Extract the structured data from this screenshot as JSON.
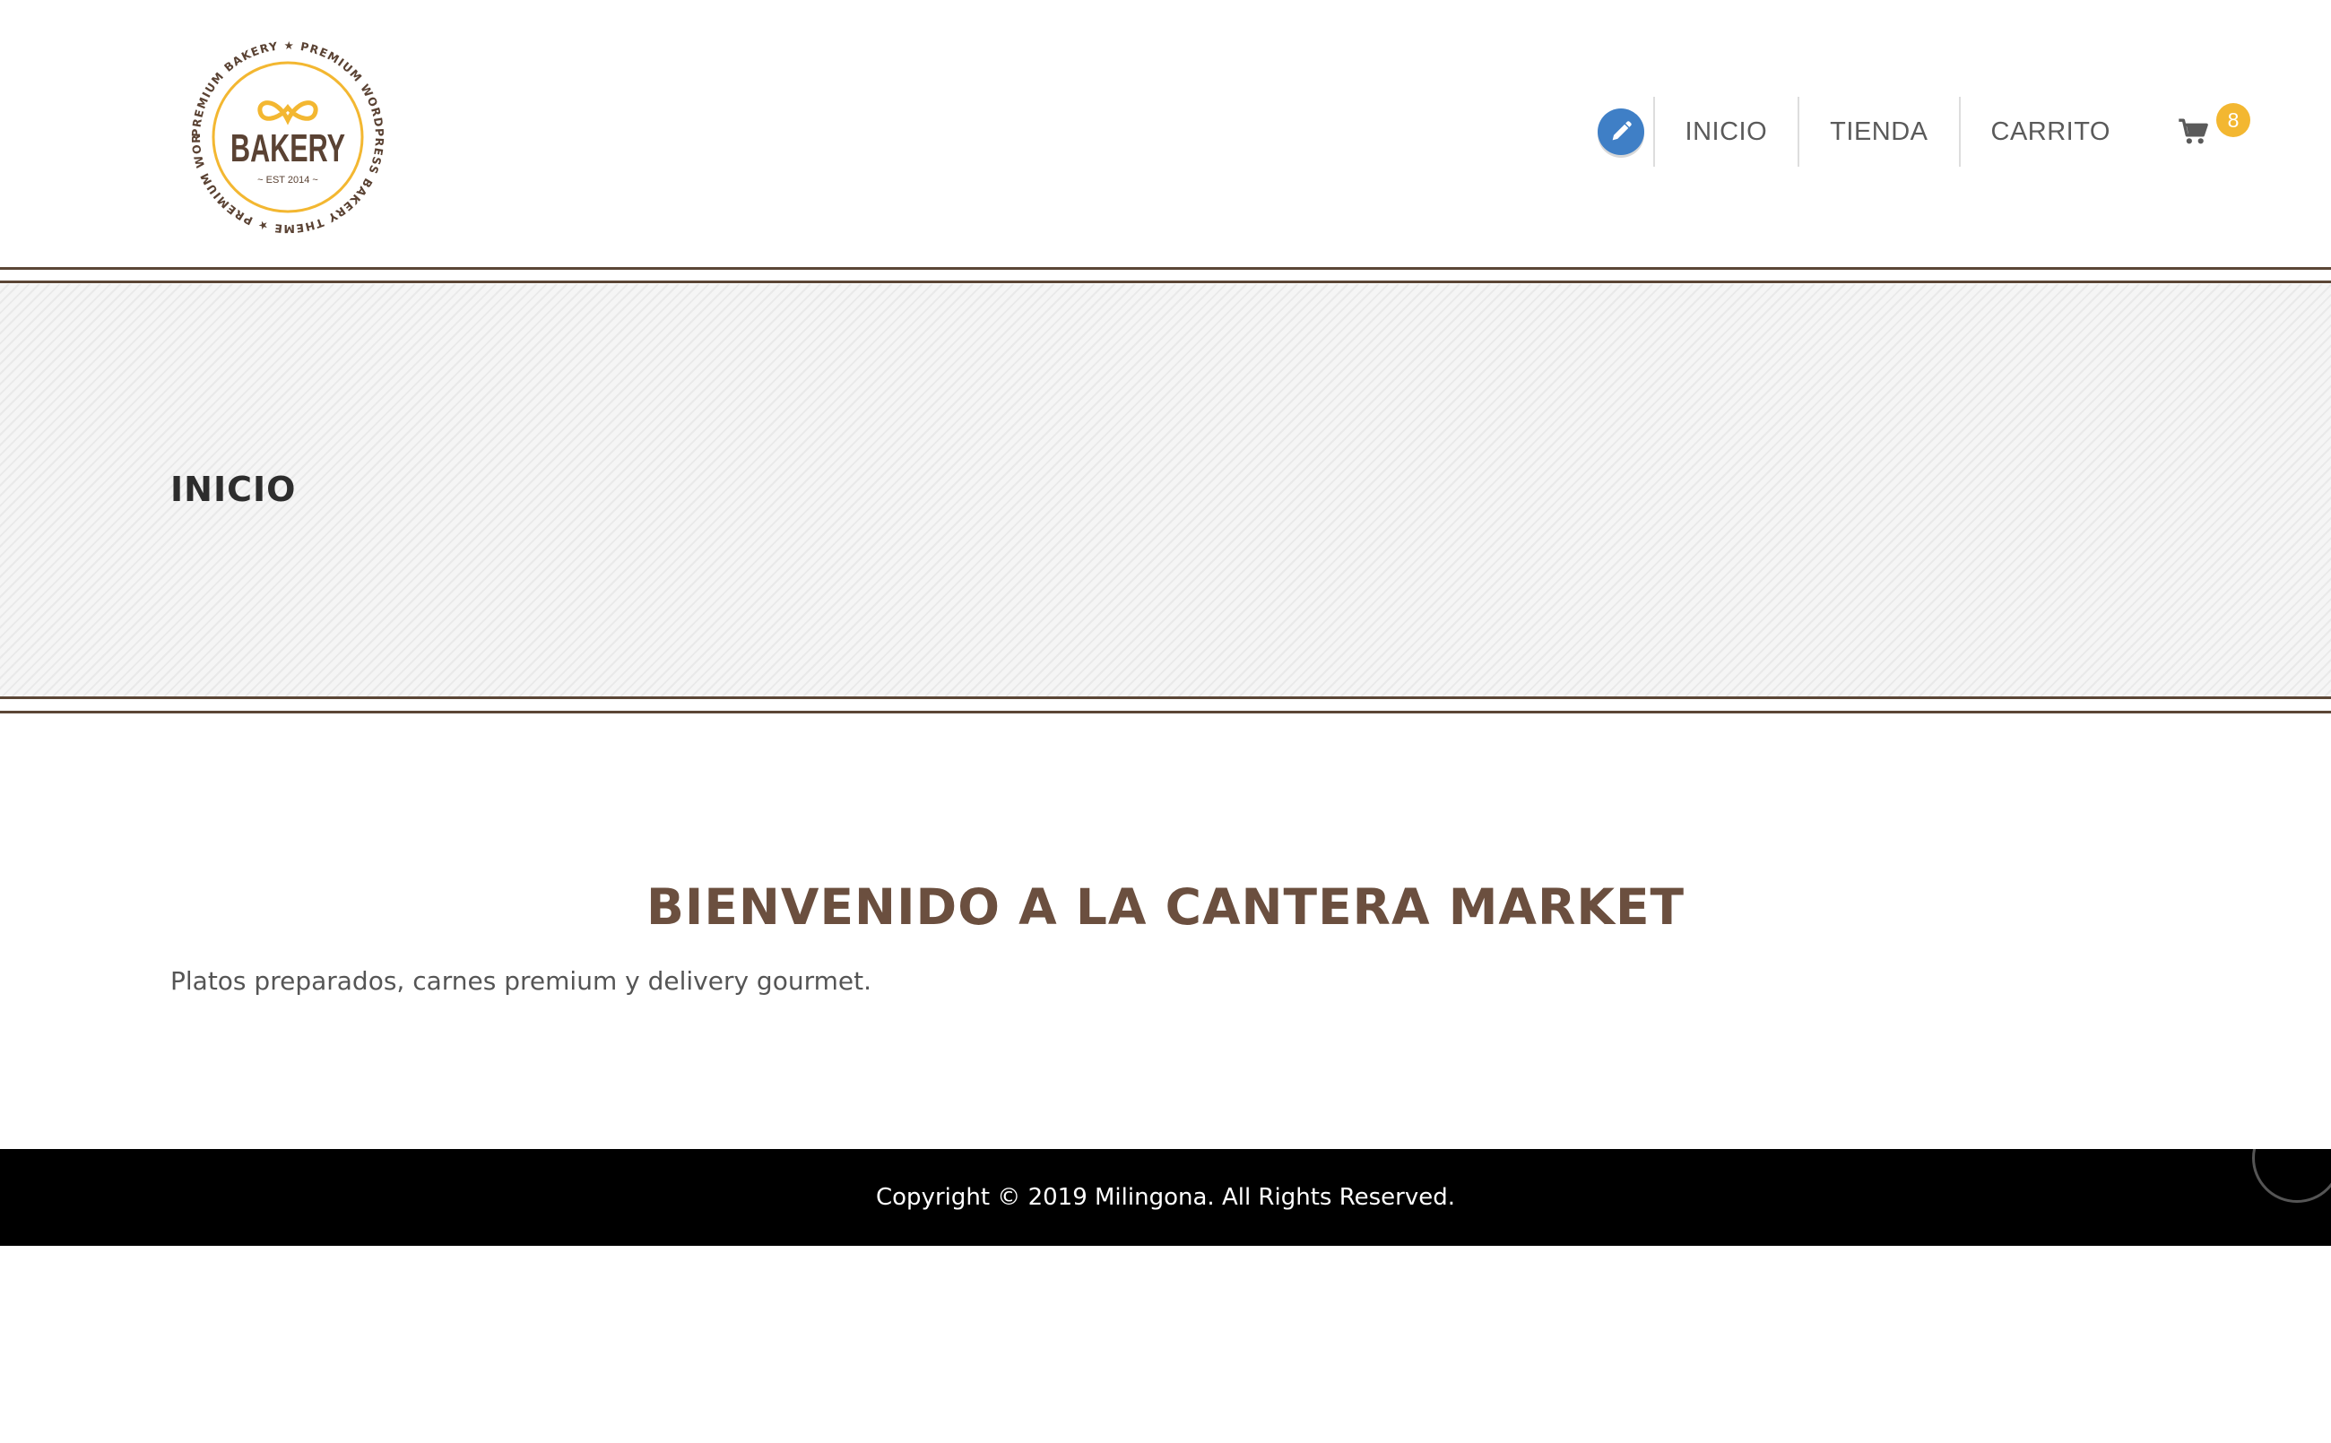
{
  "header": {
    "logo": {
      "ring_text": "PREMIUM BAKERY ★ PREMIUM WORDPRESS BAKERY THEME ★ PREMIUM WORDPRESS",
      "brand": "BAKERY",
      "est": "~ EST 2014 ~"
    },
    "nav": {
      "items": [
        {
          "label": "INICIO"
        },
        {
          "label": "TIENDA"
        },
        {
          "label": "CARRITO"
        }
      ],
      "cart_count": "8",
      "edit_icon": "pencil-icon",
      "cart_icon": "shopping-cart-icon"
    }
  },
  "page_title": "INICIO",
  "content": {
    "heading": "BIENVENIDO A LA CANTERA MARKET",
    "text": "Platos preparados, carnes premium y delivery gourmet."
  },
  "footer": {
    "copyright": "Copyright © 2019 Milingona. All Rights Reserved."
  },
  "colors": {
    "accent_brown": "#6b4f3f",
    "rule_brown": "#5b4636",
    "logo_gold": "#f3b731",
    "edit_blue": "#3f7fc6",
    "footer_bg": "#000000"
  }
}
